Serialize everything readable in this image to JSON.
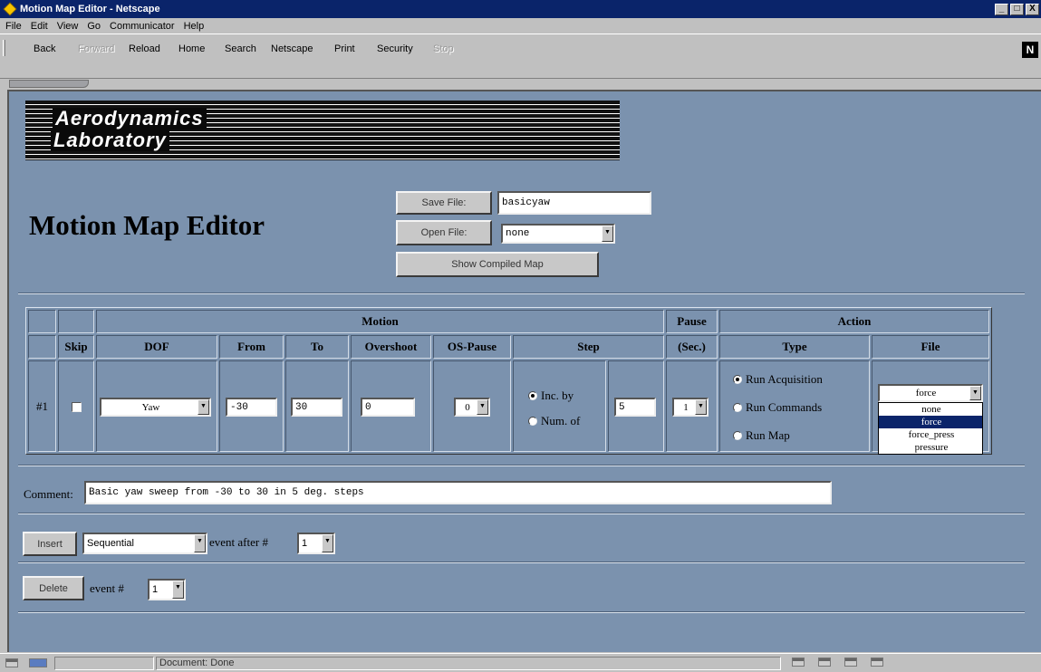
{
  "window": {
    "title": "Motion Map Editor - Netscape",
    "min_btn": "_",
    "max_btn": "□",
    "close_btn": "X"
  },
  "menu": [
    "File",
    "Edit",
    "View",
    "Go",
    "Communicator",
    "Help"
  ],
  "toolbar": {
    "back": "Back",
    "forward": "Forward",
    "reload": "Reload",
    "home": "Home",
    "search": "Search",
    "netscape": "Netscape",
    "print": "Print",
    "security": "Security",
    "stop": "Stop",
    "throbber": "N"
  },
  "banner": {
    "line1": "Aerodynamics",
    "line2": "Laboratory"
  },
  "page_title": "Motion Map Editor",
  "file_controls": {
    "save_label": "Save File:",
    "save_value": "basicyaw",
    "open_label": "Open File:",
    "open_value": "none",
    "show_compiled": "Show Compiled Map"
  },
  "table": {
    "group_headers": {
      "motion": "Motion",
      "pause": "Pause",
      "action": "Action"
    },
    "headers": {
      "skip": "Skip",
      "dof": "DOF",
      "from": "From",
      "to": "To",
      "overshoot": "Overshoot",
      "os_pause": "OS-Pause",
      "step": "Step",
      "pause_sec": "(Sec.)",
      "type": "Type",
      "file": "File"
    },
    "row": {
      "num": "#1",
      "skip_checked": false,
      "dof": "Yaw",
      "from": "-30",
      "to": "30",
      "overshoot": "0",
      "os_pause": "0",
      "step_inc_label": "Inc. by",
      "step_num_label": "Num. of",
      "step_value": "5",
      "step_mode": "inc",
      "pause": "1",
      "type_options": [
        "Run Acquisition",
        "Run Commands",
        "Run Map"
      ],
      "type_selected": 0,
      "file_value": "force",
      "file_options": [
        "none",
        "force",
        "force_press",
        "pressure"
      ],
      "file_highlight": 1
    }
  },
  "comment": {
    "label": "Comment:",
    "value": "Basic yaw sweep from -30 to 30 in 5 deg. steps"
  },
  "insert": {
    "button": "Insert",
    "mode": "Sequential",
    "after_label": "event after #",
    "after_value": "1"
  },
  "delete": {
    "button": "Delete",
    "label": "event #",
    "value": "1"
  },
  "status": {
    "text": "Document: Done"
  },
  "colors": {
    "page_bg": "#7b92ae",
    "chrome_bg": "#c0c0c0",
    "title_bar": "#0a246a",
    "selection": "#0a246a"
  }
}
